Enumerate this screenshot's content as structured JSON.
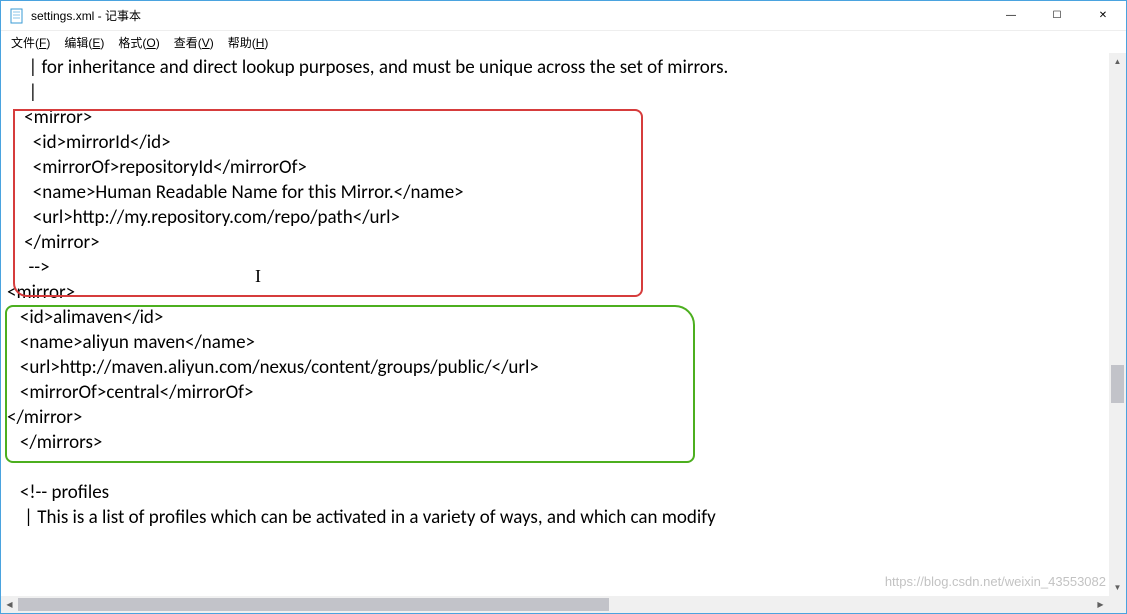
{
  "window": {
    "title": "settings.xml - 记事本",
    "min": "—",
    "max": "☐",
    "close": "✕"
  },
  "menu": {
    "file": "文件(F)",
    "edit": "编辑(E)",
    "format": "格式(O)",
    "view": "查看(V)",
    "help": "帮助(H)"
  },
  "lines": [
    "     | for inheritance and direct lookup purposes, and must be unique across the set of mirrors.",
    "     |",
    "    <mirror>",
    "      <id>mirrorId</id>",
    "      <mirrorOf>repositoryId</mirrorOf>",
    "      <name>Human Readable Name for this Mirror.</name>",
    "      <url>http://my.repository.com/repo/path</url>",
    "    </mirror>",
    "     -->",
    "<mirror>",
    "   <id>alimaven</id>",
    "   <name>aliyun maven</name>",
    "   <url>http://maven.aliyun.com/nexus/content/groups/public/</url>",
    "   <mirrorOf>central</mirrorOf>",
    "</mirror>",
    "   </mirrors>",
    "",
    "   <!-- profiles",
    "    | This is a list of profiles which can be activated in a variety of ways, and which can modify"
  ],
  "watermark": "https://blog.csdn.net/weixin_43553082",
  "scroll": {
    "up": "▲",
    "down": "▼",
    "left": "◀",
    "right": "▶"
  }
}
